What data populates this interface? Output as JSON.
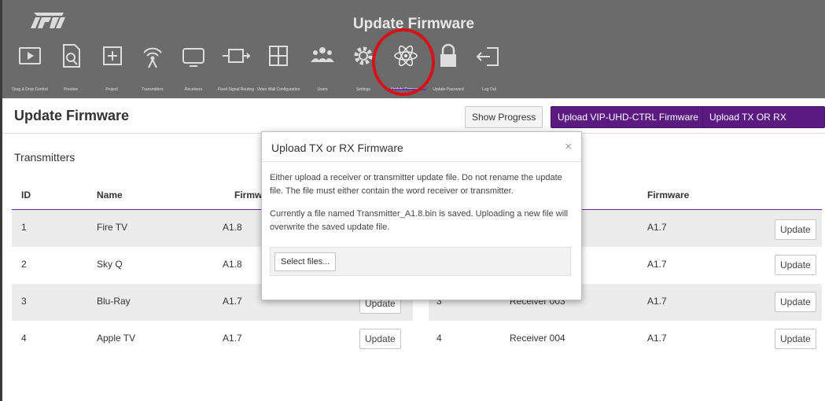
{
  "app": {
    "title": "Update Firmware"
  },
  "nav": [
    {
      "label": "Drag & Drop Control",
      "icon": "play-icon"
    },
    {
      "label": "Preview",
      "icon": "document-search-icon"
    },
    {
      "label": "Project",
      "icon": "plus-box-icon"
    },
    {
      "label": "Transmitters",
      "icon": "broadcast-icon"
    },
    {
      "label": "Receivers",
      "icon": "monitor-icon"
    },
    {
      "label": "Fixed Signal Routing",
      "icon": "routing-icon"
    },
    {
      "label": "Video Wall Configuration",
      "icon": "grid-icon"
    },
    {
      "label": "Users",
      "icon": "users-icon"
    },
    {
      "label": "Settings",
      "icon": "gear-icon"
    },
    {
      "label": "Update Firmware",
      "icon": "atom-icon"
    },
    {
      "label": "Update Password",
      "icon": "lock-icon"
    },
    {
      "label": "Log Out",
      "icon": "logout-icon"
    }
  ],
  "page": {
    "title": "Update Firmware"
  },
  "buttons": {
    "show_progress": "Show Progress",
    "upload_vip": "Upload VIP-UHD-CTRL Firmware",
    "upload_txrx": "Upload TX OR RX Firmware"
  },
  "transmitters": {
    "title": "Transmitters",
    "headers": {
      "id": "ID",
      "name": "Name",
      "firmware": "Firmware"
    },
    "rows": [
      {
        "id": "1",
        "name": "Fire TV",
        "firmware": "A1.8"
      },
      {
        "id": "2",
        "name": "Sky Q",
        "firmware": "A1.8"
      },
      {
        "id": "3",
        "name": "Blu-Ray",
        "firmware": "A1.7",
        "action": "Update"
      },
      {
        "id": "4",
        "name": "Apple TV",
        "firmware": "A1.7",
        "action": "Update"
      }
    ]
  },
  "receivers": {
    "headers": {
      "firmware": "Firmware"
    },
    "rows": [
      {
        "id": "",
        "name": "",
        "firmware": "A1.7",
        "action": "Update"
      },
      {
        "id": "",
        "name": "",
        "firmware": "A1.7",
        "action": "Update"
      },
      {
        "id": "3",
        "name": "Receiver 003",
        "firmware": "A1.7",
        "action": "Update"
      },
      {
        "id": "4",
        "name": "Receiver 004",
        "firmware": "A1.7",
        "action": "Update"
      }
    ]
  },
  "modal": {
    "title": "Upload TX or RX Firmware",
    "close": "×",
    "paragraph1": "Either upload a receiver or transmitter update file. Do not rename the update file. The file must either contain the word receiver or transmitter.",
    "paragraph2": "Currently a file named Transmitter_A1.8.bin is saved. Uploading a new file will overwrite the saved update file.",
    "select_files": "Select files..."
  },
  "colors": {
    "header": "#6b6b6b",
    "accent": "#5b1a80",
    "highlight": "#d4121a"
  }
}
